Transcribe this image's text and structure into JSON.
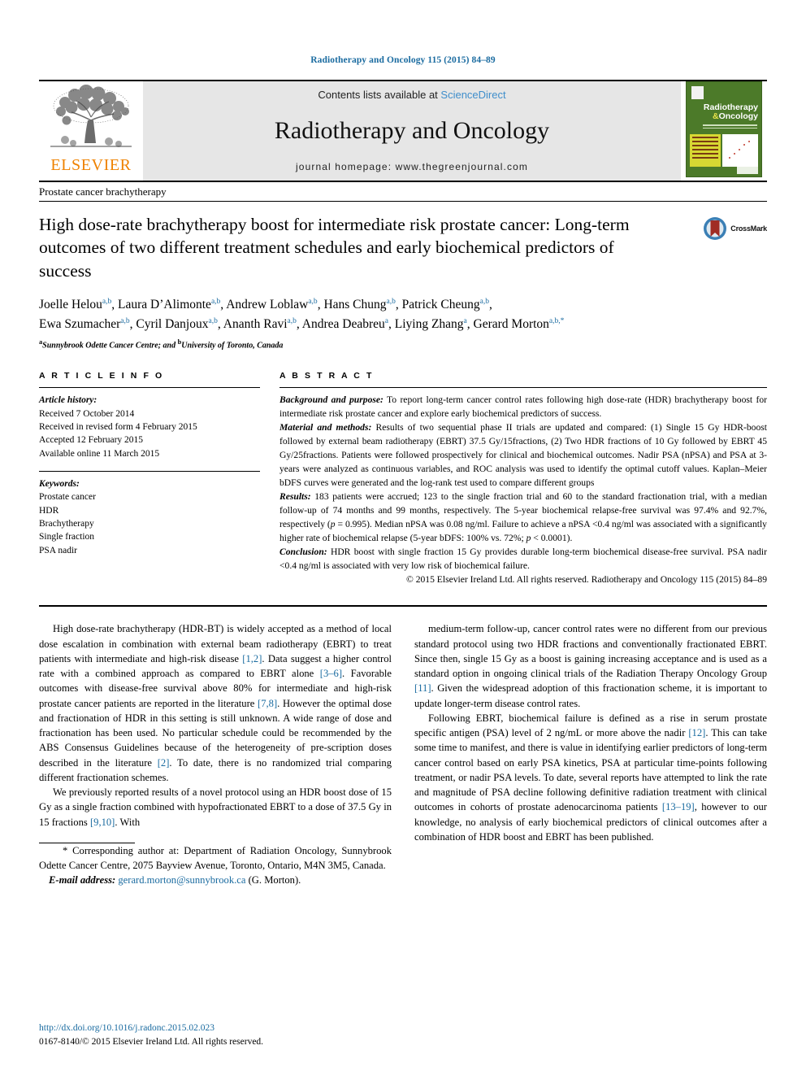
{
  "running_head": "Radiotherapy and Oncology 115 (2015) 84–89",
  "masthead": {
    "publisher_name": "ELSEVIER",
    "contents_prefix": "Contents lists available at ",
    "contents_link": "ScienceDirect",
    "journal_title": "Radiotherapy and Oncology",
    "homepage": "journal homepage: www.thegreenjournal.com",
    "cover": {
      "line1": "Radiotherapy",
      "line2_amp": "&",
      "line2": "Oncology"
    }
  },
  "section_label": "Prostate cancer brachytherapy",
  "article": {
    "title": "High dose-rate brachytherapy boost for intermediate risk prostate cancer: Long-term outcomes of two different treatment schedules and early biochemical predictors of success",
    "crossmark_label": "CrossMark",
    "authors": [
      {
        "name": "Joelle Helou",
        "sup": "a,b"
      },
      {
        "name": "Laura D’Alimonte",
        "sup": "a,b"
      },
      {
        "name": "Andrew Loblaw",
        "sup": "a,b"
      },
      {
        "name": "Hans Chung",
        "sup": "a,b"
      },
      {
        "name": "Patrick Cheung",
        "sup": "a,b"
      },
      {
        "name": "Ewa Szumacher",
        "sup": "a,b"
      },
      {
        "name": "Cyril Danjoux",
        "sup": "a,b"
      },
      {
        "name": "Ananth Ravi",
        "sup": "a,b"
      },
      {
        "name": "Andrea Deabreu",
        "sup": "a"
      },
      {
        "name": "Liying Zhang",
        "sup": "a"
      },
      {
        "name": "Gerard Morton",
        "sup": "a,b,*"
      }
    ],
    "affiliation_a_sup": "a",
    "affiliation_a": "Sunnybrook Odette Cancer Centre; and ",
    "affiliation_b_sup": "b",
    "affiliation_b": "University of Toronto, Canada"
  },
  "article_info": {
    "heading": "A R T I C L E   I N F O",
    "history_label": "Article history:",
    "history": [
      "Received 7 October 2014",
      "Received in revised form 4 February 2015",
      "Accepted 12 February 2015",
      "Available online 11 March 2015"
    ],
    "keywords_label": "Keywords:",
    "keywords": [
      "Prostate cancer",
      "HDR",
      "Brachytherapy",
      "Single fraction",
      "PSA nadir"
    ]
  },
  "abstract": {
    "heading": "A B S T R A C T",
    "background_label": "Background and purpose:",
    "background_text": " To report long-term cancer control rates following high dose-rate (HDR) brachytherapy boost for intermediate risk prostate cancer and explore early biochemical predictors of success.",
    "methods_label": "Material and methods:",
    "methods_text": " Results of two sequential phase II trials are updated and compared: (1) Single 15 Gy HDR-boost followed by external beam radiotherapy (EBRT) 37.5 Gy/15fractions, (2) Two HDR fractions of 10 Gy followed by EBRT 45 Gy/25fractions. Patients were followed prospectively for clinical and biochemical outcomes. Nadir PSA (nPSA) and PSA at 3-years were analyzed as continuous variables, and ROC analysis was used to identify the optimal cutoff values. Kaplan–Meier bDFS curves were generated and the log-rank test used to compare different groups",
    "results_label": "Results:",
    "results_text_1": " 183 patients were accrued; 123 to the single fraction trial and 60 to the standard fractionation trial, with a median follow-up of 74 months and 99 months, respectively. The 5-year biochemical relapse-free survival was 97.4% and 92.7%, respectively (",
    "results_p_italic": "p",
    "results_text_2": " = 0.995). Median nPSA was 0.08 ng/ml. Failure to achieve a nPSA <0.4 ng/ml was associated with a significantly higher rate of biochemical relapse (5-year bDFS: 100% vs. 72%; ",
    "results_text_3": " < 0.0001).",
    "conclusion_label": "Conclusion:",
    "conclusion_text": " HDR boost with single fraction 15 Gy provides durable long-term biochemical disease-free survival. PSA nadir <0.4 ng/ml is associated with very low risk of biochemical failure.",
    "copyright": "© 2015 Elsevier Ireland Ltd. All rights reserved. Radiotherapy and Oncology 115 (2015) 84–89"
  },
  "body": {
    "left": {
      "p1_a": "High dose-rate brachytherapy (HDR-BT) is widely accepted as a method of local dose escalation in combination with external beam radiotherapy (EBRT) to treat patients with intermediate and high-risk disease ",
      "p1_r1": "[1,2]",
      "p1_b": ". Data suggest a higher control rate with a combined approach as compared to EBRT alone ",
      "p1_r2": "[3–6]",
      "p1_c": ". Favorable outcomes with disease-free survival above 80% for intermediate and high-risk prostate cancer patients are reported in the literature ",
      "p1_r3": "[7,8]",
      "p1_d": ". However the optimal dose and fractionation of HDR in this setting is still unknown. A wide range of dose and fractionation has been used. No particular schedule could be recommended by the ABS Consensus Guidelines because of the heterogeneity of pre-scription doses described in the literature ",
      "p1_r4": "[2]",
      "p1_e": ". To date, there is no randomized trial comparing different fractionation schemes.",
      "p2_a": "We previously reported results of a novel protocol using an HDR boost dose of 15 Gy as a single fraction combined with hypofractionated EBRT to a dose of 37.5 Gy in 15 fractions ",
      "p2_r1": "[9,10]",
      "p2_b": ". With"
    },
    "right": {
      "p1_a": "medium-term follow-up, cancer control rates were no different from our previous standard protocol using two HDR fractions and conventionally fractionated EBRT. Since then, single 15 Gy as a boost is gaining increasing acceptance and is used as a standard option in ongoing clinical trials of the Radiation Therapy Oncology Group ",
      "p1_r1": "[11]",
      "p1_b": ". Given the widespread adoption of this fractionation scheme, it is important to update longer-term disease control rates.",
      "p2_a": "Following EBRT, biochemical failure is defined as a rise in serum prostate specific antigen (PSA) level of 2 ng/mL or more above the nadir ",
      "p2_r1": "[12]",
      "p2_b": ". This can take some time to manifest, and there is value in identifying earlier predictors of long-term cancer control based on early PSA kinetics, PSA at particular time-points following treatment, or nadir PSA levels. To date, several reports have attempted to link the rate and magnitude of PSA decline following definitive radiation treatment with clinical outcomes in cohorts of prostate adenocarcinoma patients ",
      "p2_r2": "[13–19]",
      "p2_c": ", however to our knowledge, no analysis of early biochemical predictors of clinical outcomes after a combination of HDR boost and EBRT has been published."
    }
  },
  "footnote": {
    "star": "*",
    "text": " Corresponding author at: Department of Radiation Oncology, Sunnybrook Odette Cancer Centre, 2075 Bayview Avenue, Toronto, Ontario, M4N 3M5, Canada.",
    "email_label": "E-mail address:",
    "email": "gerard.morton@sunnybrook.ca",
    "email_suffix": " (G. Morton)."
  },
  "page_footer": {
    "doi": "http://dx.doi.org/10.1016/j.radonc.2015.02.023",
    "issn_line": "0167-8140/© 2015 Elsevier Ireland Ltd. All rights reserved."
  },
  "colors": {
    "link_blue": "#1a6ba0",
    "sciencedirect_blue": "#3f8ecb",
    "elsevier_orange": "#ef8200",
    "cover_green": "#4c7a29",
    "crossmark_red": "#a02c24",
    "crossmark_blue": "#3b7fb5"
  }
}
